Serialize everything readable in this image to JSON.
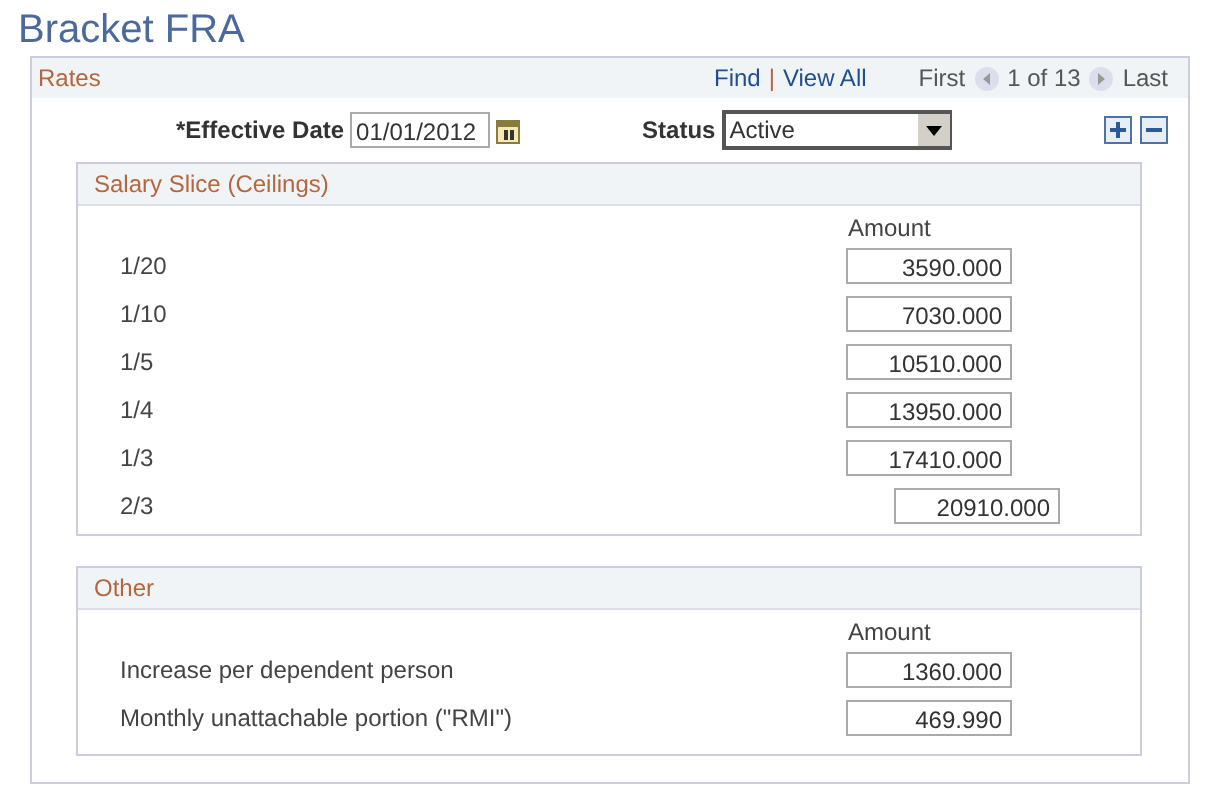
{
  "page_title": "Bracket FRA",
  "rates": {
    "title": "Rates",
    "find": "Find",
    "separator": "|",
    "view_all": "View All",
    "first": "First",
    "count": "1 of 13",
    "last": "Last",
    "effective_date": {
      "label": "*Effective Date",
      "value": "01/01/2012"
    },
    "status": {
      "label": "Status",
      "value": "Active"
    }
  },
  "sections": [
    {
      "title": "Salary Slice (Ceilings)",
      "column": "Amount",
      "rows": [
        {
          "label": "1/20",
          "amount": "3590.000",
          "kind": "standard"
        },
        {
          "label": "1/10",
          "amount": "7030.000",
          "kind": "standard"
        },
        {
          "label": "1/5",
          "amount": "10510.000",
          "kind": "standard"
        },
        {
          "label": "1/4",
          "amount": "13950.000",
          "kind": "standard"
        },
        {
          "label": "1/3",
          "amount": "17410.000",
          "kind": "standard"
        },
        {
          "label": "2/3",
          "amount": "20910.000",
          "kind": "offset"
        }
      ]
    },
    {
      "title": "Other",
      "column": "Amount",
      "rows": [
        {
          "label": "Increase per dependent person",
          "amount": "1360.000",
          "kind": "standard"
        },
        {
          "label": "Monthly unattachable portion (\"RMI\")",
          "amount": "469.990",
          "kind": "standard"
        }
      ]
    }
  ]
}
